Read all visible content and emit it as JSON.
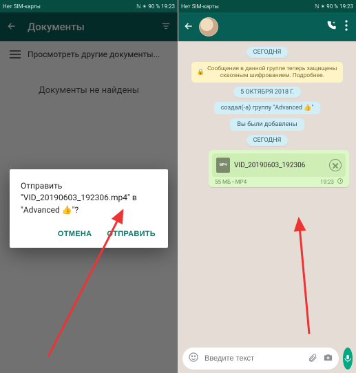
{
  "status": {
    "left": "Нет SIM-карты",
    "battery": "90 %",
    "time": "19:23"
  },
  "left": {
    "title": "Документы",
    "browse_row": "Просмотреть другие документы...",
    "not_found": "Документы не найдены",
    "dialog": {
      "line1": "Отправить",
      "line2": "\"VID_20190603_192306.mp4\" в",
      "line3": "\"Advanced 👍\"?",
      "cancel": "ОТМЕНА",
      "send": "ОТПРАВИТЬ"
    }
  },
  "right": {
    "badges": {
      "today": "СЕГОДНЯ",
      "date": "5 ОКТЯБРЯ 2018 Г."
    },
    "encryption": "Сообщения в данной группе теперь защищены сквозным шифрованием. Подробнее.",
    "created": "создал(-а) группу \"Advanced 👍\"",
    "added": "Вы были добавлены",
    "doc": {
      "name": "VID_20190603_192306",
      "meta": "55 МБ • MP4",
      "time": "19:23",
      "ext": "MP4"
    },
    "composer_placeholder": "Введите текст"
  }
}
